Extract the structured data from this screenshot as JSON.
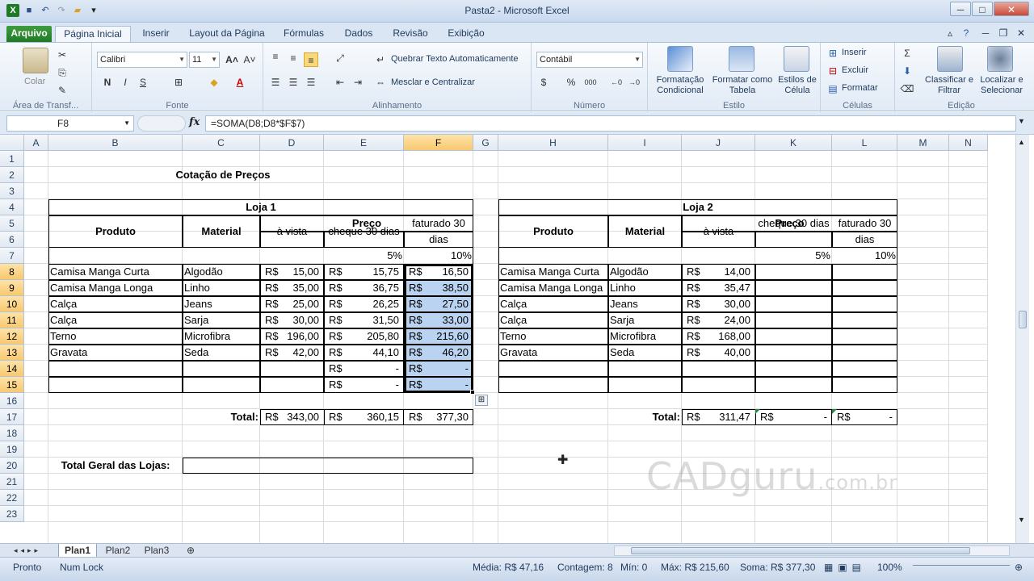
{
  "window": {
    "title": "Pasta2 - Microsoft Excel",
    "min": "─",
    "max": "□",
    "close": "✕"
  },
  "tabs": [
    "Arquivo",
    "Página Inicial",
    "Inserir",
    "Layout da Página",
    "Fórmulas",
    "Dados",
    "Revisão",
    "Exibição"
  ],
  "ribbon": {
    "clipboard": {
      "paste": "Colar",
      "label": "Área de Transf..."
    },
    "font": {
      "name": "Calibri",
      "size": "11",
      "label": "Fonte",
      "bold": "N",
      "italic": "I",
      "underline": "S"
    },
    "alignment": {
      "wrap": "Quebrar Texto Automaticamente",
      "merge": "Mesclar e Centralizar",
      "label": "Alinhamento"
    },
    "number": {
      "format": "Contábil",
      "label": "Número"
    },
    "styles": {
      "cond": "Formatação Condicional",
      "table": "Formatar como Tabela",
      "cell": "Estilos de Célula",
      "label": "Estilo"
    },
    "cells": {
      "insert": "Inserir",
      "delete": "Excluir",
      "format": "Formatar",
      "label": "Células"
    },
    "editing": {
      "sort": "Classificar e Filtrar",
      "find": "Localizar e Selecionar",
      "label": "Edição"
    }
  },
  "formula_bar": {
    "name_box": "F8",
    "fx": "fx",
    "formula": "=SOMA(D8;D8*$F$7)"
  },
  "columns": [
    "A",
    "B",
    "C",
    "D",
    "E",
    "F",
    "G",
    "H",
    "I",
    "J",
    "K",
    "L",
    "M",
    "N"
  ],
  "selected_column": "F",
  "selected_rows": [
    "8",
    "9",
    "10",
    "11",
    "12",
    "13",
    "14",
    "15"
  ],
  "rows": [
    "1",
    "2",
    "3",
    "4",
    "5",
    "6",
    "7",
    "8",
    "9",
    "10",
    "11",
    "12",
    "13",
    "14",
    "15",
    "16",
    "17",
    "18",
    "19",
    "20",
    "21",
    "22",
    "23"
  ],
  "sheet": {
    "title": "Cotação de Preços",
    "loja1": {
      "name": "Loja 1",
      "preco": "Preço",
      "produto": "Produto",
      "material": "Material",
      "avista": "à vista",
      "cheque": "cheque 30 dias",
      "faturado": "faturado 30 dias",
      "pct_cheque": "5%",
      "pct_faturado": "10%",
      "items": [
        {
          "produto": "Camisa Manga Curta",
          "material": "Algodão",
          "avista": "15,00",
          "cheque": "15,75",
          "faturado": "16,50"
        },
        {
          "produto": "Camisa Manga Longa",
          "material": "Linho",
          "avista": "35,00",
          "cheque": "36,75",
          "faturado": "38,50"
        },
        {
          "produto": "Calça",
          "material": "Jeans",
          "avista": "25,00",
          "cheque": "26,25",
          "faturado": "27,50"
        },
        {
          "produto": "Calça",
          "material": "Sarja",
          "avista": "30,00",
          "cheque": "31,50",
          "faturado": "33,00"
        },
        {
          "produto": "Terno",
          "material": "Microfibra",
          "avista": "196,00",
          "cheque": "205,80",
          "faturado": "215,60"
        },
        {
          "produto": "Gravata",
          "material": "Seda",
          "avista": "42,00",
          "cheque": "44,10",
          "faturado": "46,20"
        },
        {
          "produto": "",
          "material": "",
          "avista": "",
          "cheque": "-",
          "faturado": "-"
        },
        {
          "produto": "",
          "material": "",
          "avista": "",
          "cheque": "-",
          "faturado": "-"
        }
      ],
      "total_label": "Total:",
      "total_avista": "343,00",
      "total_cheque": "360,15",
      "total_faturado": "377,30"
    },
    "loja2": {
      "name": "Loja 2",
      "preco": "Preço",
      "produto": "Produto",
      "material": "Material",
      "avista": "à vista",
      "cheque": "cheque 30 dias",
      "faturado": "faturado 30 dias",
      "pct_cheque": "5%",
      "pct_faturado": "10%",
      "items": [
        {
          "produto": "Camisa Manga Curta",
          "material": "Algodão",
          "avista": "14,00"
        },
        {
          "produto": "Camisa Manga Longa",
          "material": "Linho",
          "avista": "35,47"
        },
        {
          "produto": "Calça",
          "material": "Jeans",
          "avista": "30,00"
        },
        {
          "produto": "Calça",
          "material": "Sarja",
          "avista": "24,00"
        },
        {
          "produto": "Terno",
          "material": "Microfibra",
          "avista": "168,00"
        },
        {
          "produto": "Gravata",
          "material": "Seda",
          "avista": "40,00"
        }
      ],
      "total_label": "Total:",
      "total_avista": "311,47",
      "total_cheque": "-",
      "total_faturado": "-"
    },
    "currency": "R$",
    "total_geral_label": "Total Geral das Lojas:"
  },
  "sheets": [
    "Plan1",
    "Plan2",
    "Plan3"
  ],
  "status": {
    "ready": "Pronto",
    "numlock": "Num Lock",
    "media": "Média:  R$ 47,16",
    "contagem": "Contagem: 8",
    "min": "Mín: 0",
    "max": "Máx:  R$ 215,60",
    "soma": "Soma:  R$ 377,30",
    "zoom": "100%"
  },
  "watermark": {
    "main": "CADguru",
    "suffix": ".com.br"
  }
}
